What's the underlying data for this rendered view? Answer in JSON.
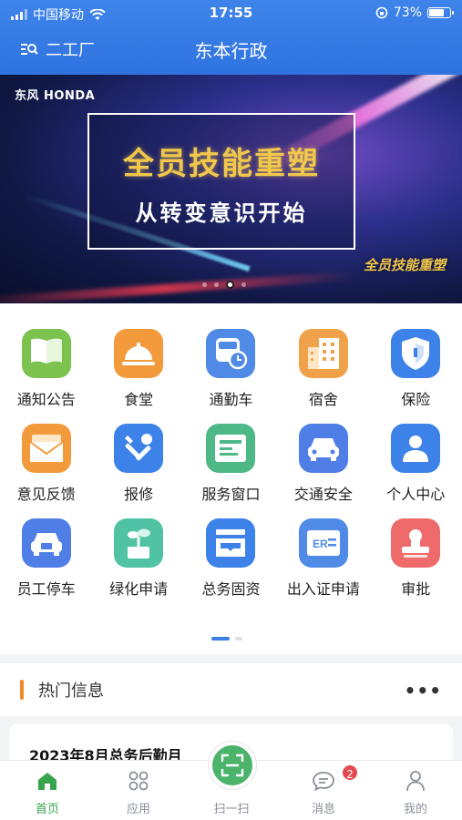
{
  "status_bar": {
    "carrier": "中国移动",
    "time": "17:55",
    "battery": "73%",
    "battery_level": 0.73
  },
  "header": {
    "location": "二工厂",
    "title": "东本行政"
  },
  "banner": {
    "brand": "东风 HONDA",
    "headline": "全员技能重塑",
    "subheadline": "从转变意识开始",
    "watermark": "全员技能重塑",
    "slide_count": 4,
    "active_slide": 3
  },
  "grid": {
    "items": [
      {
        "label": "通知公告",
        "icon": "book-icon",
        "color": "#7cc24f"
      },
      {
        "label": "食堂",
        "icon": "dining-bell-icon",
        "color": "#f39a3c"
      },
      {
        "label": "通勤车",
        "icon": "bus-clock-icon",
        "color": "#4f8ae6"
      },
      {
        "label": "宿舍",
        "icon": "building-icon",
        "color": "#f0a24a"
      },
      {
        "label": "保险",
        "icon": "shield-icon",
        "color": "#3d82e8"
      },
      {
        "label": "意见反馈",
        "icon": "envelope-icon",
        "color": "#f39a3c"
      },
      {
        "label": "报修",
        "icon": "tools-icon",
        "color": "#3d82e8"
      },
      {
        "label": "服务窗口",
        "icon": "service-window-icon",
        "color": "#4fb887"
      },
      {
        "label": "交通安全",
        "icon": "car-icon",
        "color": "#4f7ee6"
      },
      {
        "label": "个人中心",
        "icon": "person-icon",
        "color": "#3d82e8"
      },
      {
        "label": "员工停车",
        "icon": "parking-car-icon",
        "color": "#4f7ee6"
      },
      {
        "label": "绿化申请",
        "icon": "plant-icon",
        "color": "#4fc3a4"
      },
      {
        "label": "总务固资",
        "icon": "inbox-icon",
        "color": "#3d82e8"
      },
      {
        "label": "出入证申请",
        "icon": "id-card-icon",
        "color": "#4f8ae6"
      },
      {
        "label": "审批",
        "icon": "stamp-icon",
        "color": "#ef6b6b"
      }
    ],
    "page_count": 2,
    "active_page": 1
  },
  "hot": {
    "title": "热门信息",
    "more": "•••"
  },
  "news": {
    "first_title": "2023年8月总务后勤月"
  },
  "tabbar": {
    "items": [
      {
        "label": "首页",
        "icon": "home-icon",
        "active": true
      },
      {
        "label": "应用",
        "icon": "apps-icon",
        "active": false
      },
      {
        "label": "扫一扫",
        "icon": "scan-icon",
        "active": false
      },
      {
        "label": "消息",
        "icon": "message-icon",
        "active": false,
        "badge": "2"
      },
      {
        "label": "我的",
        "icon": "user-icon",
        "active": false
      }
    ]
  }
}
